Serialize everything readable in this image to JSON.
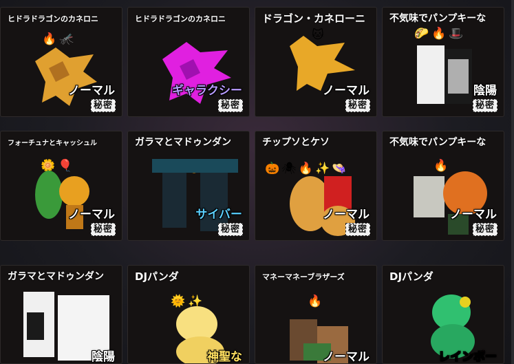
{
  "cards": [
    {
      "name": "ヒドラドラゴンのカネロニ",
      "rarity": "ノーマル",
      "rarity_color": "#ffffff",
      "secret": "秘密",
      "badges": [
        "fire-icon",
        "bug-icon"
      ],
      "sprite_color": "#e0a030"
    },
    {
      "name": "ヒドラドラゴンのカネロニ",
      "rarity": "ギャラクシー",
      "rarity_color": "#b89cff",
      "secret": "秘密",
      "badges": [],
      "sprite_color": "#e020e0"
    },
    {
      "name": "ドラゴン・カネローニ",
      "rarity": "ノーマル",
      "rarity_color": "#ffffff",
      "secret": "秘密",
      "badges": [
        "cat-icon"
      ],
      "sprite_color": "#e8a828"
    },
    {
      "name": "不気味でパンプキーな",
      "rarity": "陰陽",
      "rarity_color": "#ffffff",
      "secret": "秘密",
      "badges": [
        "taco-icon",
        "fire-icon",
        "hat-icon"
      ],
      "sprite_color": "#f0f0f0"
    },
    {
      "name": "フォーチュナとキャッシュル",
      "rarity": "ノーマル",
      "rarity_color": "#ffffff",
      "secret": "秘密",
      "badges": [
        "flower-icon",
        "balloon-icon"
      ],
      "sprite_color": "#3a9a3a"
    },
    {
      "name": "ガラマとマドゥンダン",
      "rarity": "サイバー",
      "rarity_color": "#5ad0ff",
      "secret": "秘密",
      "badges": [
        "bug-icon",
        "fire-icon"
      ],
      "sprite_color": "#1a3a4a"
    },
    {
      "name": "チップソとケソ",
      "rarity": "ノーマル",
      "rarity_color": "#ffffff",
      "secret": "秘密",
      "badges": [
        "pumpkin-icon",
        "spider-icon",
        "fire-icon",
        "star-icon",
        "hat-icon"
      ],
      "sprite_color": "#e0a040"
    },
    {
      "name": "不気味でパンプキーな",
      "rarity": "ノーマル",
      "rarity_color": "#ffffff",
      "secret": "秘密",
      "badges": [
        "fire-icon"
      ],
      "sprite_color": "#e07020"
    },
    {
      "name": "ガラマとマドゥンダン",
      "rarity": "陰陽",
      "rarity_color": "#ffffff",
      "secret": "",
      "badges": [],
      "sprite_color": "#f0f0f0"
    },
    {
      "name": "DJパンダ",
      "rarity": "神聖な",
      "rarity_color": "#ffe060",
      "secret": "",
      "badges": [
        "sun-icon",
        "sparkle-icon"
      ],
      "sprite_color": "#f8e080"
    },
    {
      "name": "マネーマネーブラザーズ",
      "rarity": "ノーマル",
      "rarity_color": "#ffffff",
      "secret": "",
      "badges": [
        "fire-icon"
      ],
      "sprite_color": "#9a6a40"
    },
    {
      "name": "DJパンダ",
      "rarity": "レインボー",
      "rarity_color": "rainbow",
      "secret": "",
      "badges": [],
      "sprite_color": "#30c070"
    }
  ],
  "badge_glyphs": {
    "fire-icon": "🔥",
    "bug-icon": "🦟",
    "cat-icon": "🐱",
    "taco-icon": "🌮",
    "hat-icon": "🎩",
    "flower-icon": "🌼",
    "balloon-icon": "🎈",
    "pumpkin-icon": "🎃",
    "spider-icon": "🕷",
    "star-icon": "✨",
    "sun-icon": "🌞",
    "sparkle-icon": "✨"
  }
}
